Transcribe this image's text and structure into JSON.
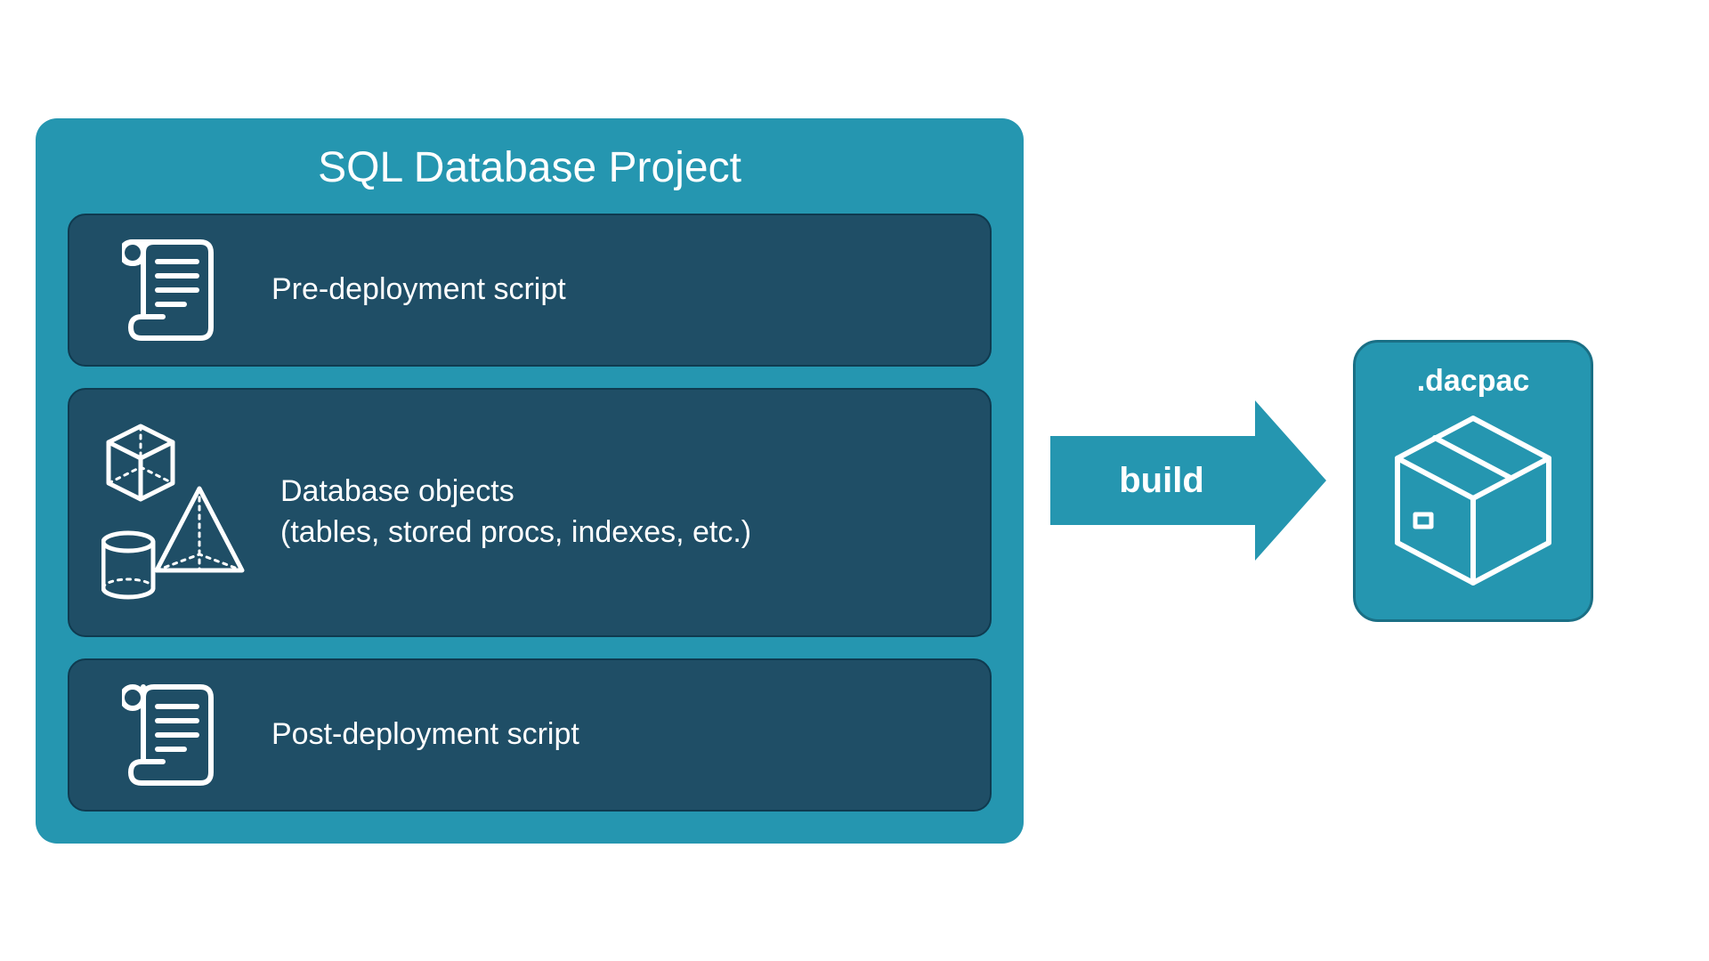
{
  "project": {
    "title": "SQL Database Project",
    "sections": {
      "pre": {
        "label": "Pre-deployment script"
      },
      "objects": {
        "line1": "Database objects",
        "line2": "(tables, stored procs, indexes, etc.)"
      },
      "post": {
        "label": "Post-deployment script"
      }
    }
  },
  "arrow": {
    "label": "build"
  },
  "output": {
    "label": ".dacpac"
  },
  "colors": {
    "teal": "#2596b0",
    "darkTeal": "#1f4e66",
    "white": "#ffffff"
  }
}
